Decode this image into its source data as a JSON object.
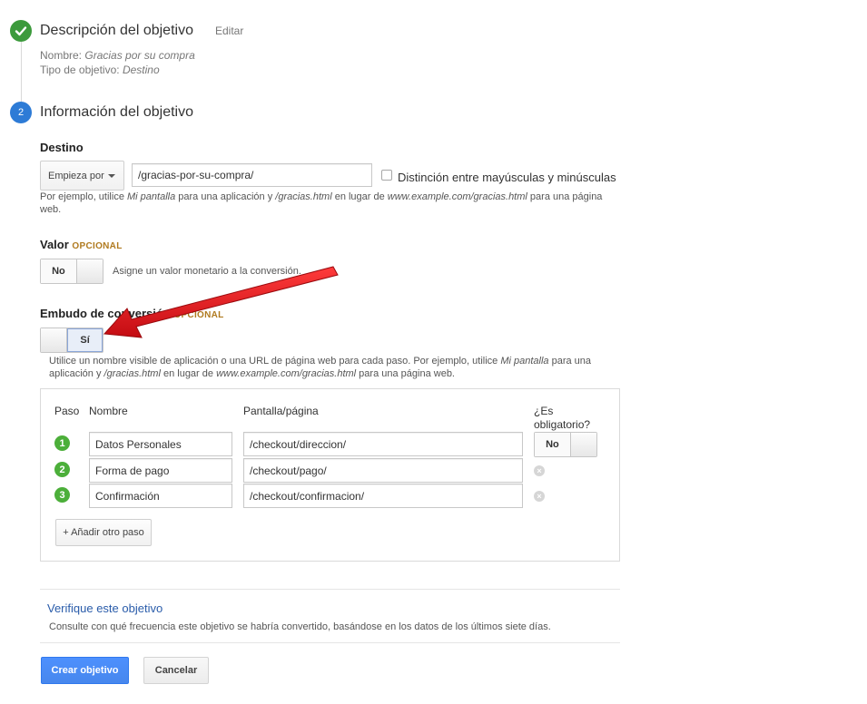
{
  "step1": {
    "title": "Descripción del objetivo",
    "edit_label": "Editar",
    "name_label": "Nombre: ",
    "name_value": "Gracias por su compra",
    "type_label": "Tipo de objetivo: ",
    "type_value": "Destino"
  },
  "step2": {
    "number": "2",
    "title": "Información del objetivo"
  },
  "destino": {
    "label": "Destino",
    "match_select": "Empieza por",
    "url_value": "/gracias-por-su-compra/",
    "case_sensitive_label": "Distinción entre mayúsculas y minúsculas",
    "help_1": "Por ejemplo, utilice ",
    "help_em1": "Mi pantalla",
    "help_2": " para una aplicación y ",
    "help_em2": "/gracias.html",
    "help_3": " en lugar de ",
    "help_em3": "www.example.com/gracias.html",
    "help_4": " para una página",
    "help_5": "web."
  },
  "valor": {
    "label": "Valor",
    "optional": "OPCIONAL",
    "toggle_label": "No",
    "hint": "Asigne un valor monetario a la conversión."
  },
  "embudo": {
    "label": "Embudo de conversión",
    "optional": "OPCIONAL",
    "toggle_label": "Sí",
    "help_1": "Utilice un nombre visible de aplicación o una URL de página web para cada paso. Por ejemplo, utilice ",
    "help_em1": "Mi pantalla",
    "help_2": " para una",
    "help_3": "aplicación y ",
    "help_em2": "/gracias.html",
    "help_4": " en lugar de ",
    "help_em3": "www.example.com/gracias.html",
    "help_5": " para una página web.",
    "headers": {
      "step": "Paso",
      "name": "Nombre",
      "page": "Pantalla/página",
      "required_1": "¿Es",
      "required_2": "obligatorio?"
    },
    "rows": [
      {
        "num": "1",
        "name": "Datos Personales",
        "page": "/checkout/direccion/"
      },
      {
        "num": "2",
        "name": "Forma de pago",
        "page": "/checkout/pago/"
      },
      {
        "num": "3",
        "name": "Confirmación",
        "page": "/checkout/confirmacion/"
      }
    ],
    "required_toggle": "No",
    "add_step": "+ Añadir otro paso"
  },
  "verify": {
    "link": "Verifique este objetivo",
    "desc": "Consulte con qué frecuencia este objetivo se habría convertido, basándose en los datos de los últimos siete días."
  },
  "actions": {
    "create": "Crear objetivo",
    "cancel": "Cancelar"
  },
  "colors": {
    "step_done": "#3c9a3c",
    "step_active": "#2d7bd6",
    "primary": "#4d90fe",
    "annotation_arrow": "#e0141c"
  }
}
